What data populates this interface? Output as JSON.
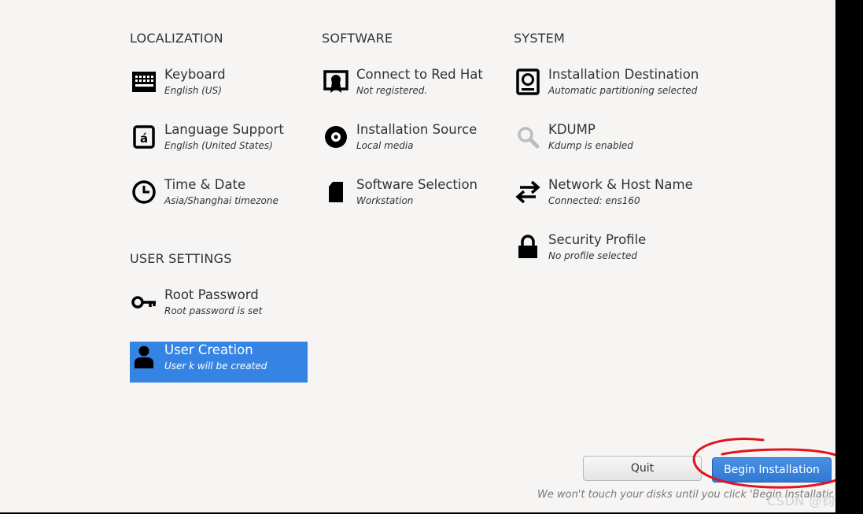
{
  "sections": {
    "localization": "LOCALIZATION",
    "software": "SOFTWARE",
    "system": "SYSTEM",
    "user_settings": "USER SETTINGS"
  },
  "spokes": {
    "keyboard": {
      "title": "Keyboard",
      "status": "English (US)",
      "icon": "keyboard-icon"
    },
    "language": {
      "title": "Language Support",
      "status": "English (United States)",
      "icon": "language-icon"
    },
    "time": {
      "title": "Time & Date",
      "status": "Asia/Shanghai timezone",
      "icon": "clock-icon"
    },
    "connect": {
      "title": "Connect to Red Hat",
      "status": "Not registered.",
      "icon": "certificate-icon"
    },
    "source": {
      "title": "Installation Source",
      "status": "Local media",
      "icon": "disc-icon"
    },
    "software": {
      "title": "Software Selection",
      "status": "Workstation",
      "icon": "package-icon"
    },
    "destination": {
      "title": "Installation Destination",
      "status": "Automatic partitioning selected",
      "icon": "harddisk-icon"
    },
    "kdump": {
      "title": "KDUMP",
      "status": "Kdump is enabled",
      "icon": "magnifier-icon"
    },
    "network": {
      "title": "Network & Host Name",
      "status": "Connected: ens160",
      "icon": "network-arrows-icon"
    },
    "security": {
      "title": "Security Profile",
      "status": "No profile selected",
      "icon": "lock-icon"
    },
    "root": {
      "title": "Root Password",
      "status": "Root password is set",
      "icon": "key-icon"
    },
    "user": {
      "title": "User Creation",
      "status": "User k will be created",
      "icon": "user-icon"
    }
  },
  "buttons": {
    "quit": "Quit",
    "begin": "Begin Installation"
  },
  "footnote": "We won't touch your disks until you click 'Begin Installation'.",
  "watermark": "CSDN @钧粤",
  "colors": {
    "background": "#f6f5f4",
    "selected": "#3584e4",
    "text": "#2e3436",
    "annotation": "#e0141b"
  }
}
